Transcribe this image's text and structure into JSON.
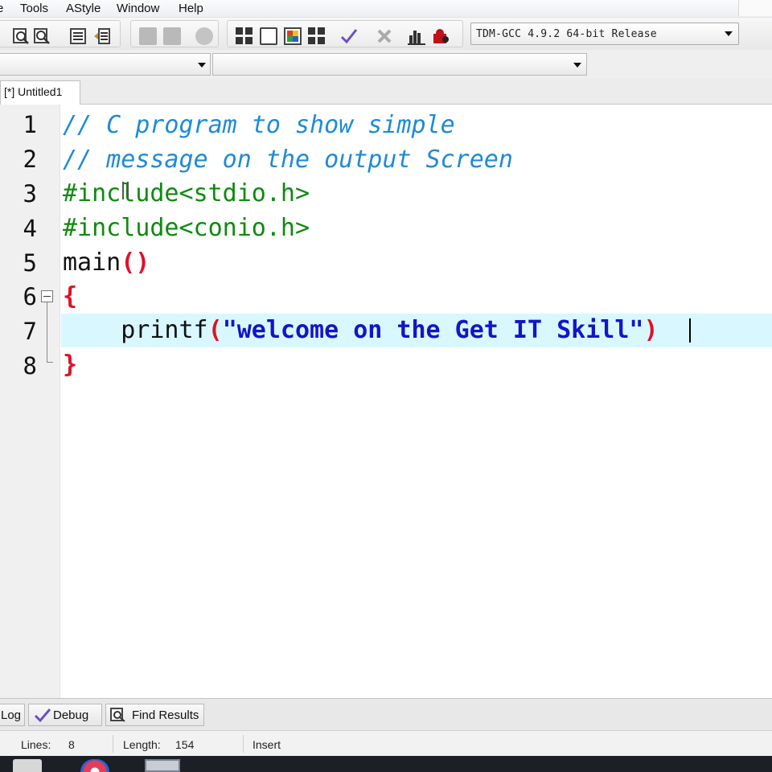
{
  "menu": {
    "file": "e",
    "tools": "Tools",
    "astyle": "AStyle",
    "window": "Window",
    "help": "Help"
  },
  "toolbar": {
    "compiler": "TDM-GCC 4.9.2 64-bit Release",
    "icons": [
      "find-icon",
      "replace-icon",
      "indent-icon",
      "unindent-icon",
      "back-icon",
      "forward-icon",
      "toggle-icon",
      "new-project-icon",
      "window-icon",
      "class-icon",
      "grid-icon",
      "check-icon",
      "stop-icon",
      "chart-icon",
      "profile-icon"
    ]
  },
  "editor": {
    "tab_label": "[*] Untitled1",
    "line_numbers": [
      "1",
      "2",
      "3",
      "4",
      "5",
      "6",
      "7",
      "8"
    ],
    "lines": {
      "l1": "// C program to show simple",
      "l2": "// message on the output Screen",
      "l3": "#include<stdio.h>",
      "l4": "#include<conio.h>",
      "l5_a": "main",
      "l5_b": "()",
      "l6": "{",
      "l7_a": "    printf",
      "l7_b": "(",
      "l7_c": "\"welcome on the Get IT Skill\"",
      "l7_d": ")",
      "l8": "}"
    }
  },
  "bottom_tabs": {
    "log": "Log",
    "debug": "Debug",
    "find": "Find Results"
  },
  "status": {
    "lines_label": "Lines:",
    "lines_value": "8",
    "length_label": "Length:",
    "length_value": "154",
    "mode": "Insert"
  },
  "colors": {
    "comment": "#1e8bd6",
    "preprocessor": "#0f8a0f",
    "brace": "#e0102a",
    "string": "#1414c8",
    "current_line": "#d9f7ff"
  }
}
